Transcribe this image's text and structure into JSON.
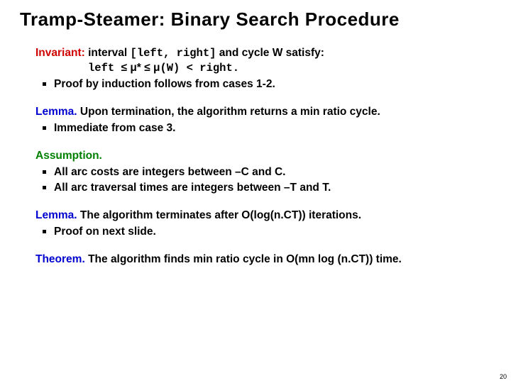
{
  "title": "Tramp-Steamer:  Binary Search Procedure",
  "invariant": {
    "label": "Invariant:",
    "text_before": "interval ",
    "code1": "[left, right]",
    "text_mid": " and cycle W satisfy:",
    "line2_a": "left ",
    "line2_b": "≤ μ* ≤ μ",
    "line2_c": "(W) < right.",
    "bullet": "Proof by induction follows from cases 1-2."
  },
  "lemma1": {
    "label": "Lemma.",
    "text": "Upon termination, the algorithm returns a min ratio cycle.",
    "bullet": "Immediate from case 3."
  },
  "assumption": {
    "label": "Assumption.",
    "bullet1": "All arc costs are integers between –C and C.",
    "bullet2": "All arc traversal times are integers between –T and T."
  },
  "lemma2": {
    "label": "Lemma.",
    "text": "The algorithm terminates after O(log(n.CT)) iterations.",
    "bullet": "Proof on next slide."
  },
  "theorem": {
    "label": "Theorem.",
    "text": "The algorithm finds min ratio cycle in O(mn log (n.CT)) time."
  },
  "page": "20"
}
